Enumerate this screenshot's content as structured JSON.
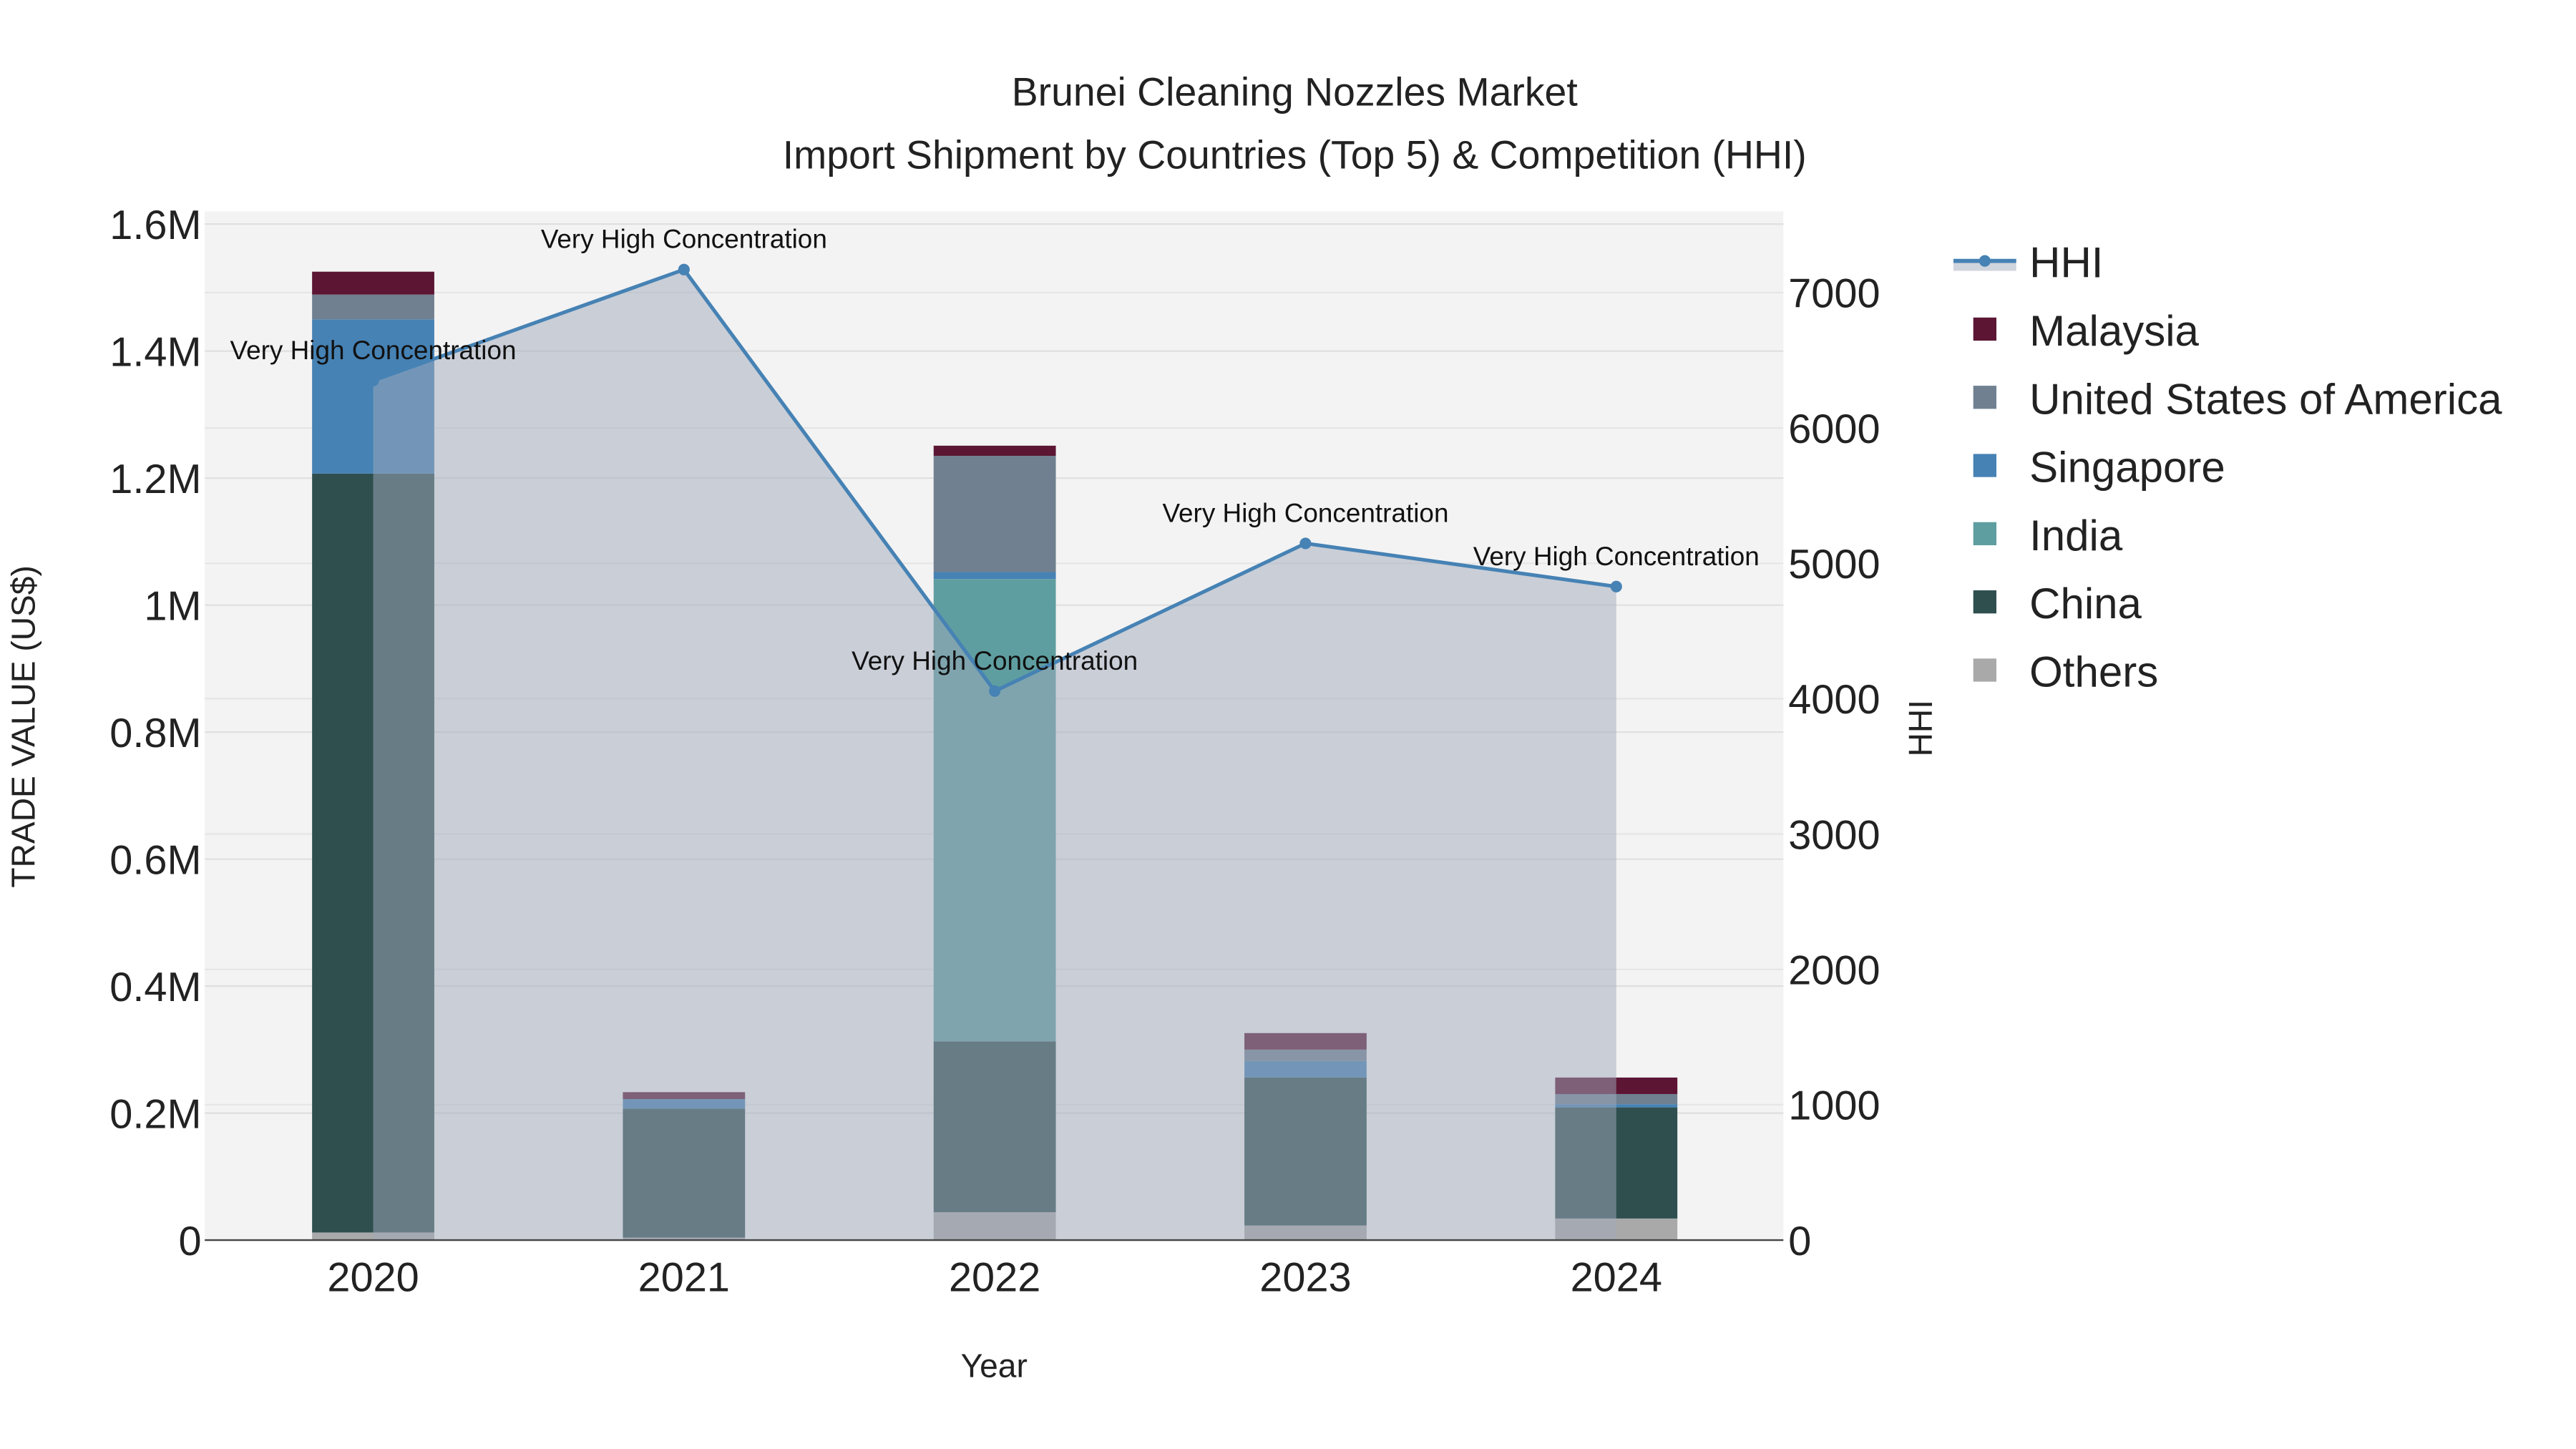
{
  "chart_data": {
    "type": "bar",
    "title": "Brunei Cleaning Nozzles Market",
    "subtitle": "Import Shipment by Countries (Top 5) & Competition (HHI)",
    "xlabel": "Year",
    "ylabel": "TRADE VALUE (US$)",
    "y2label": "HHI",
    "categories": [
      "2020",
      "2021",
      "2022",
      "2023",
      "2024"
    ],
    "ylim": [
      0,
      1620000
    ],
    "y2lim": [
      0,
      7600
    ],
    "yticks": [
      0,
      200000,
      400000,
      600000,
      800000,
      1000000,
      1200000,
      1400000,
      1600000
    ],
    "ytick_labels": [
      "0",
      "0.2M",
      "0.4M",
      "0.6M",
      "0.8M",
      "1M",
      "1.2M",
      "1.4M",
      "1.6M"
    ],
    "y2ticks": [
      0,
      1000,
      2000,
      3000,
      4000,
      5000,
      6000,
      7000
    ],
    "y2tick_labels": [
      "0",
      "1000",
      "2000",
      "3000",
      "4000",
      "5000",
      "6000",
      "7000"
    ],
    "series": [
      {
        "name": "Others",
        "color": "#a9a9a9",
        "values": [
          12000,
          4000,
          44000,
          23000,
          34000
        ]
      },
      {
        "name": "China",
        "color": "#2f4f4f",
        "values": [
          1195000,
          203000,
          269000,
          233000,
          175000
        ]
      },
      {
        "name": "India",
        "color": "#5f9ea0",
        "values": [
          0,
          0,
          728000,
          0,
          0
        ]
      },
      {
        "name": "Singapore",
        "color": "#4682b4",
        "values": [
          243000,
          15000,
          11000,
          26000,
          5000
        ]
      },
      {
        "name": "United States of America",
        "color": "#708090",
        "values": [
          39000,
          0,
          183000,
          18000,
          16000
        ]
      },
      {
        "name": "Malaysia",
        "color": "#5c1634",
        "values": [
          36000,
          11000,
          16000,
          26000,
          26000
        ]
      }
    ],
    "hhi": {
      "name": "HHI",
      "color": "#4682b4",
      "values": [
        6350,
        7170,
        4056,
        5147,
        4828
      ],
      "annotations": [
        "Very High Concentration",
        "Very High Concentration",
        "Very High Concentration",
        "Very High Concentration",
        "Very High Concentration"
      ]
    },
    "legend_order": [
      "HHI",
      "Malaysia",
      "United States of America",
      "Singapore",
      "India",
      "China",
      "Others"
    ],
    "legend_position": "right",
    "grid": true
  }
}
